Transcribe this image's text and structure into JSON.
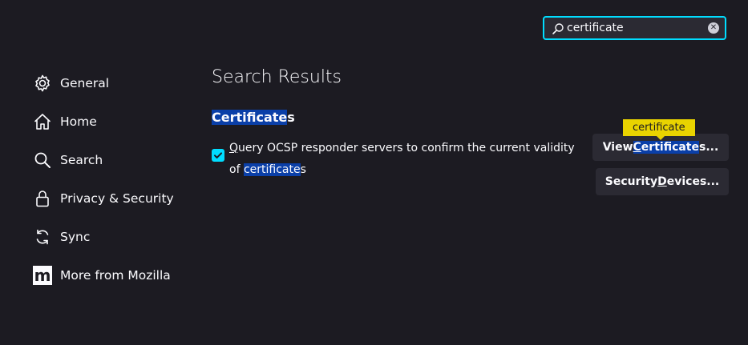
{
  "search": {
    "value": "certificate",
    "icon": "search-icon",
    "clear_icon": "clear-icon"
  },
  "sidebar": {
    "items": [
      {
        "label": "General",
        "icon": "gear-icon"
      },
      {
        "label": "Home",
        "icon": "home-icon"
      },
      {
        "label": "Search",
        "icon": "search-icon"
      },
      {
        "label": "Privacy & Security",
        "icon": "lock-icon"
      },
      {
        "label": "Sync",
        "icon": "sync-icon"
      },
      {
        "label": "More from Mozilla",
        "icon": "mozilla-icon"
      }
    ],
    "mozilla_logo_letter": "m"
  },
  "main": {
    "title": "Search Results",
    "section": {
      "heading_highlight": "Certificate",
      "heading_rest": "s"
    },
    "ocsp": {
      "checked": true,
      "text_first_letter": "Q",
      "text_main": "uery OCSP responder servers to confirm the current validity of ",
      "text_highlight": "certificate",
      "text_end": "s"
    },
    "view_button": {
      "prefix": "View ",
      "underlined": "C",
      "highlight": "ertificate",
      "suffix": "s..."
    },
    "security_button": {
      "prefix": "Security ",
      "underlined": "D",
      "suffix": "evices..."
    },
    "tooltip": "certificate"
  },
  "colors": {
    "background": "#1c1b22",
    "accent": "#00ddff",
    "highlight": "#0a3fa8",
    "tooltip": "#e9d300",
    "button_bg": "#2b2a33"
  }
}
